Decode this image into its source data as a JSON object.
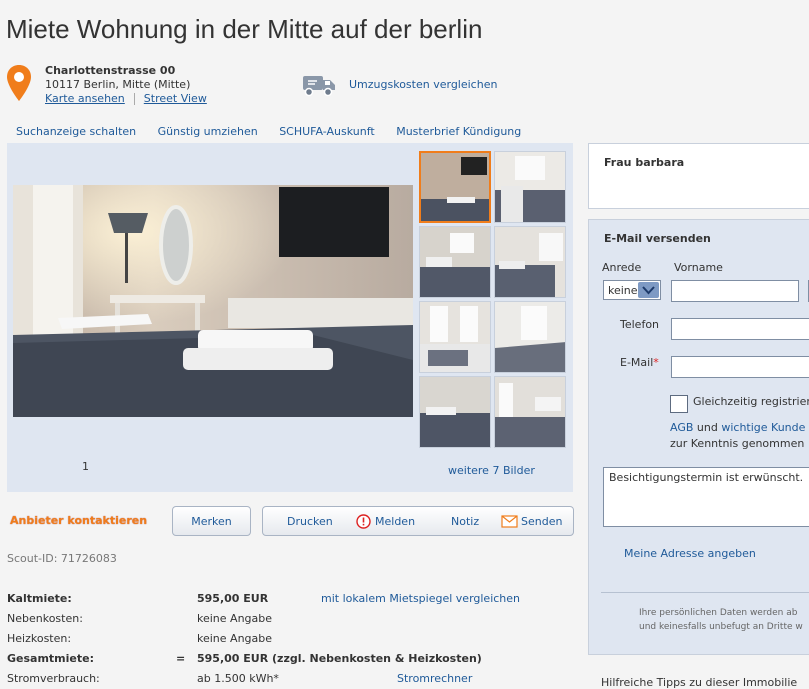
{
  "title": "Miete Wohnung in der Mitte auf der berlin",
  "address": {
    "street": "Charlottenstrasse 00",
    "city": "10117 Berlin, Mitte (Mitte)",
    "map_link": "Karte ansehen",
    "street_view_link": "Street View"
  },
  "umzug_link": "Umzugskosten vergleichen",
  "top_nav": [
    "Suchanzeige schalten",
    "Günstig umziehen",
    "SCHUFA-Auskunft",
    "Musterbrief Kündigung"
  ],
  "gallery": {
    "counter": "1",
    "more_images": "weitere 7 Bilder"
  },
  "actions": {
    "contact": "Anbieter kontaktieren",
    "merken": "Merken",
    "drucken": "Drucken",
    "melden": "Melden",
    "notiz": "Notiz",
    "senden": "Senden"
  },
  "scout_id": "Scout-ID: 71726083",
  "costs": [
    {
      "label": "Kaltmiete:",
      "eq": "",
      "value": "595,00 EUR",
      "link": "mit lokalem Mietspiegel vergleichen",
      "bold": true
    },
    {
      "label": "Nebenkosten:",
      "eq": "",
      "value": "keine Angabe",
      "link": "",
      "bold": false
    },
    {
      "label": "Heizkosten:",
      "eq": "",
      "value": "keine Angabe",
      "link": "",
      "bold": false
    },
    {
      "label": "Gesamtmiete:",
      "eq": "=",
      "value": "595,00 EUR (zzgl. Nebenkosten & Heizkosten)",
      "link": "",
      "bold": true
    },
    {
      "label": "Stromverbrauch:",
      "eq": "",
      "value": "ab 1.500 kWh*",
      "link": "Stromrechner",
      "bold": false
    }
  ],
  "contact_person": "Frau barbara",
  "email_form": {
    "heading": "E-Mail versenden",
    "anrede_label": "Anrede",
    "anrede_value": "keine",
    "vorname_label": "Vorname",
    "telefon_label": "Telefon",
    "email_label": "E-Mail",
    "required_mark": "*",
    "register_label": "Gleichzeitig registrieren",
    "agb_text_1": "AGB",
    "agb_text_2": "und",
    "agb_text_3": "wichtige Kunde",
    "agb_text_4": "zur Kenntnis genommen",
    "message": "Besichtigungstermin ist erwünscht.",
    "address_link": "Meine Adresse angeben",
    "privacy_1": "Ihre persönlichen Daten werden ab",
    "privacy_2": "und keinesfalls unbefugt an Dritte w"
  },
  "tips": "Hilfreiche Tipps zu dieser Immobilie",
  "colors": {
    "accent": "#f07d1b",
    "link": "#1f5a99",
    "panel": "#dfe6f1"
  }
}
